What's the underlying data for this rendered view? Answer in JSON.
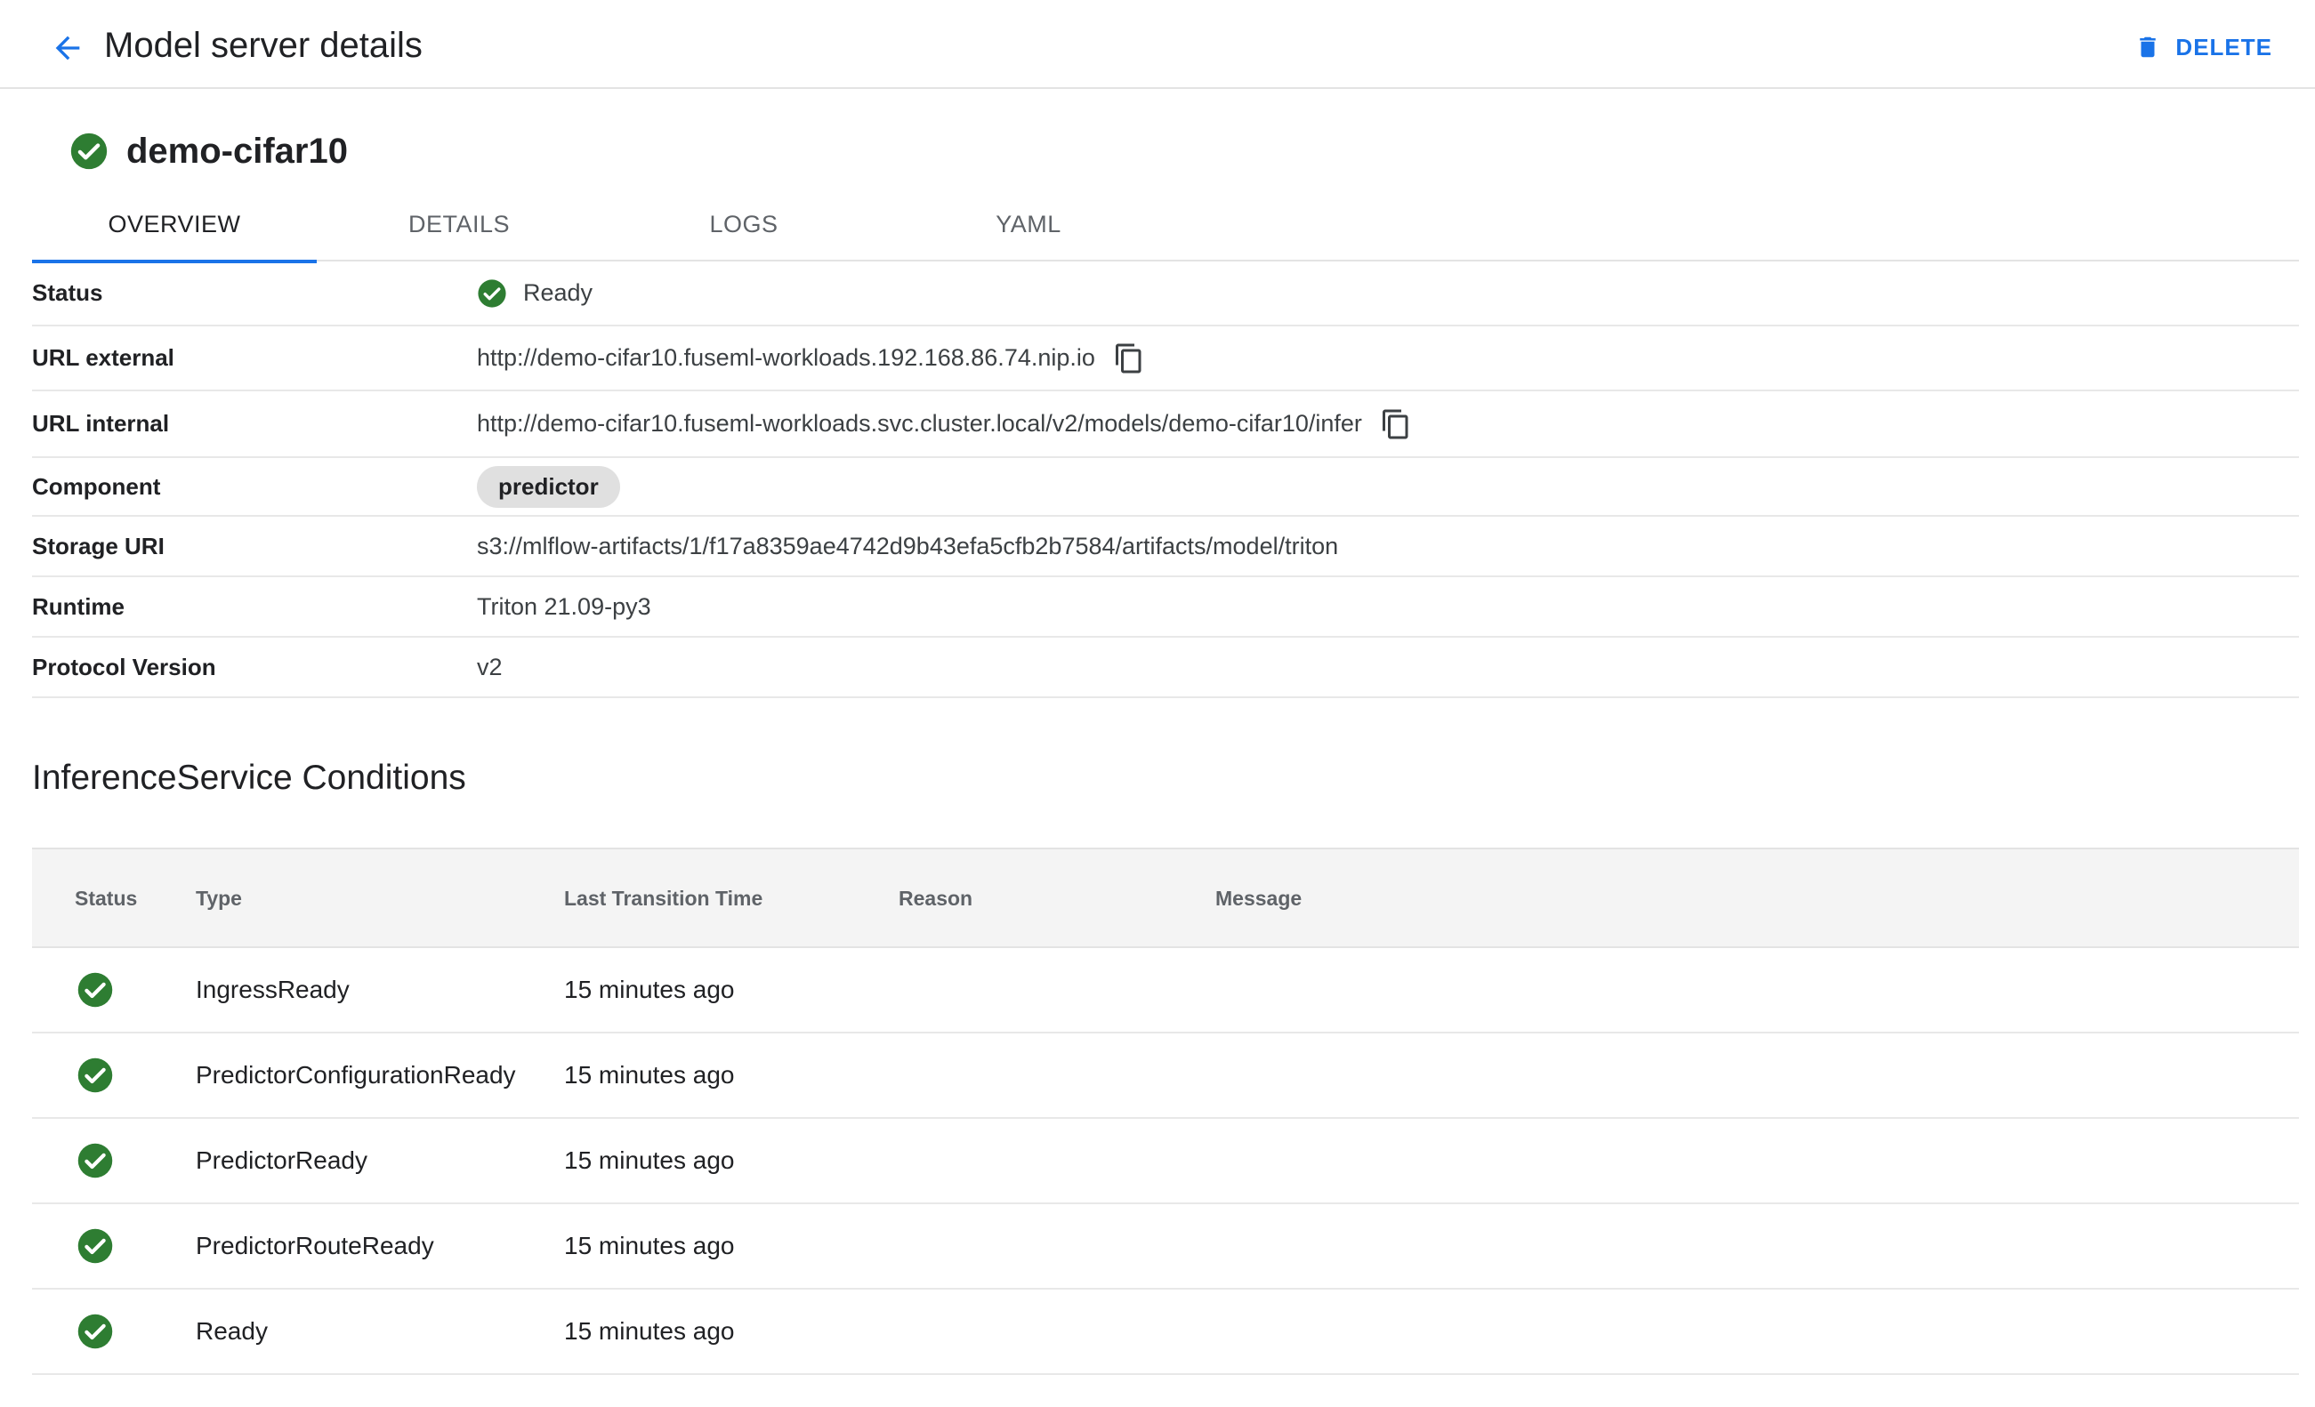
{
  "header": {
    "title": "Model server details",
    "delete_label": "DELETE"
  },
  "resource": {
    "name": "demo-cifar10",
    "status_color": "#2e7d32"
  },
  "tabs": [
    {
      "label": "OVERVIEW",
      "active": true
    },
    {
      "label": "DETAILS",
      "active": false
    },
    {
      "label": "LOGS",
      "active": false
    },
    {
      "label": "YAML",
      "active": false
    }
  ],
  "properties": {
    "status": {
      "label": "Status",
      "value": "Ready"
    },
    "url_external": {
      "label": "URL external",
      "value": "http://demo-cifar10.fuseml-workloads.192.168.86.74.nip.io"
    },
    "url_internal": {
      "label": "URL internal",
      "value": "http://demo-cifar10.fuseml-workloads.svc.cluster.local/v2/models/demo-cifar10/infer"
    },
    "component": {
      "label": "Component",
      "value": "predictor"
    },
    "storage_uri": {
      "label": "Storage URI",
      "value": "s3://mlflow-artifacts/1/f17a8359ae4742d9b43efa5cfb2b7584/artifacts/model/triton"
    },
    "runtime": {
      "label": "Runtime",
      "value": "Triton 21.09-py3"
    },
    "protocol_version": {
      "label": "Protocol Version",
      "value": "v2"
    }
  },
  "conditions": {
    "title": "InferenceService Conditions",
    "columns": {
      "status": "Status",
      "type": "Type",
      "time": "Last Transition Time",
      "reason": "Reason",
      "message": "Message"
    },
    "rows": [
      {
        "type": "IngressReady",
        "time": "15 minutes ago",
        "reason": "",
        "message": ""
      },
      {
        "type": "PredictorConfigurationReady",
        "time": "15 minutes ago",
        "reason": "",
        "message": ""
      },
      {
        "type": "PredictorReady",
        "time": "15 minutes ago",
        "reason": "",
        "message": ""
      },
      {
        "type": "PredictorRouteReady",
        "time": "15 minutes ago",
        "reason": "",
        "message": ""
      },
      {
        "type": "Ready",
        "time": "15 minutes ago",
        "reason": "",
        "message": ""
      }
    ]
  },
  "colors": {
    "accent": "#1a73e8",
    "success": "#2e7d32"
  }
}
